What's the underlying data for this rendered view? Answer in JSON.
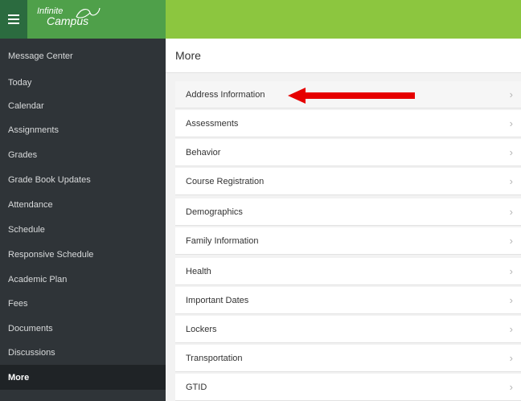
{
  "header": {
    "menu_icon": "hamburger-icon",
    "logo_line1": "Infinite",
    "logo_line2": "Campus",
    "logo_mark_icon": "campus-swoosh-icon",
    "brand_color": "#8cc63f"
  },
  "sidebar": {
    "items": [
      {
        "label": "Message Center"
      },
      {
        "label": "Today"
      },
      {
        "label": "Calendar"
      },
      {
        "label": "Assignments"
      },
      {
        "label": "Grades"
      },
      {
        "label": "Grade Book Updates"
      },
      {
        "label": "Attendance"
      },
      {
        "label": "Schedule"
      },
      {
        "label": "Responsive Schedule"
      },
      {
        "label": "Academic Plan"
      },
      {
        "label": "Fees"
      },
      {
        "label": "Documents"
      },
      {
        "label": "Discussions"
      },
      {
        "label": "More",
        "active": true
      }
    ]
  },
  "main": {
    "title": "More",
    "list": [
      {
        "label": "Address Information",
        "highlighted": true
      },
      {
        "label": "Assessments"
      },
      {
        "label": "Behavior"
      },
      {
        "label": "Course Registration"
      },
      {
        "label": "Demographics"
      },
      {
        "label": "Family Information"
      },
      {
        "label": "Health"
      },
      {
        "label": "Important Dates"
      },
      {
        "label": "Lockers"
      },
      {
        "label": "Transportation"
      },
      {
        "label": "GTID"
      }
    ],
    "chevron_icon": "chevron-right-icon",
    "annotation": {
      "icon": "red-arrow-icon",
      "color": "#e60000"
    }
  }
}
